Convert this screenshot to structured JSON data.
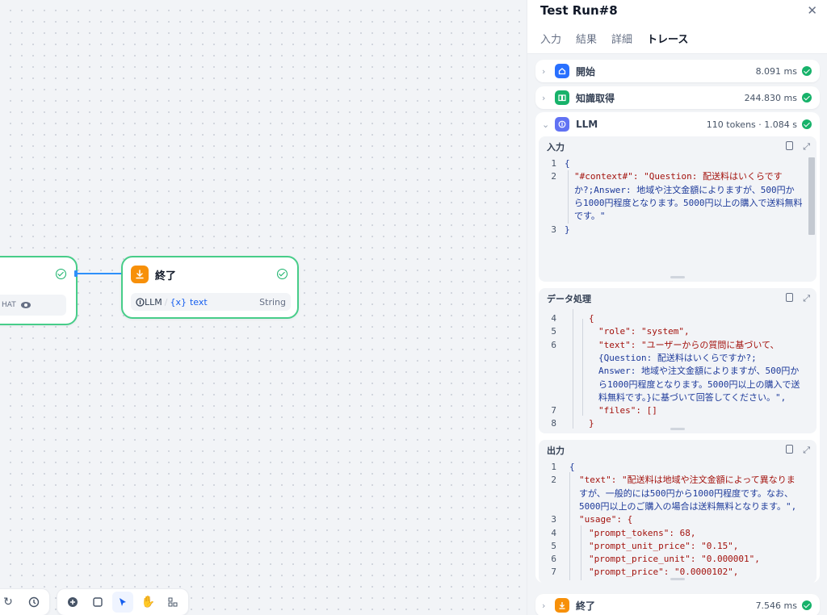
{
  "canvas": {
    "left_node": {
      "var_label": "HAT"
    },
    "end_node": {
      "title": "終了",
      "var_source": "LLM",
      "var_name": "text",
      "var_type": "String"
    }
  },
  "panel": {
    "title": "Test Run#8",
    "tabs": [
      "入力",
      "結果",
      "詳細",
      "トレース"
    ],
    "active_tab": "トレース",
    "trace": [
      {
        "title": "開始",
        "meta": "8.091 ms",
        "icon": "home-icon",
        "color": "#2970ff"
      },
      {
        "title": "知識取得",
        "meta": "244.830 ms",
        "icon": "book-icon",
        "color": "#17b26a"
      },
      {
        "title": "LLM",
        "meta": "110 tokens · 1.084 s",
        "icon": "llm-icon",
        "color": "#6172f3"
      },
      {
        "title": "終了",
        "meta": "7.546 ms",
        "icon": "end-icon",
        "color": "#f79009"
      }
    ],
    "input_section": {
      "title": "入力",
      "line_numbers": [
        "1",
        "2",
        "3"
      ],
      "lines": [
        "{",
        "\"#context#\": \"Question: 配送料はいくらです",
        "か?;Answer: 地域や注文金額によりますが、500円か",
        "ら1000円程度となります。5000円以上の購入で送料無料",
        "です。\"",
        "}"
      ]
    },
    "processing_section": {
      "title": "データ処理",
      "line_numbers": [
        "4",
        "5",
        "6",
        "7",
        "8"
      ],
      "lines": [
        "{",
        "\"role\": \"system\",",
        "\"text\": \"ユーザーからの質問に基づいて、",
        "{Question: 配送料はいくらですか?;",
        "Answer: 地域や注文金額によりますが、500円か",
        "ら1000円程度となります。5000円以上の購入で送",
        "料無料です。}に基づいて回答してください。\",",
        "\"files\": []",
        "}"
      ]
    },
    "output_section": {
      "title": "出力",
      "line_numbers": [
        "1",
        "2",
        "3",
        "4",
        "5",
        "6",
        "7"
      ],
      "lines": [
        "{",
        "\"text\": \"配送料は地域や注文金額によって異なりま",
        "すが、一般的には500円から1000円程度です。なお、",
        "5000円以上のご購入の場合は送料無料となります。\",",
        "\"usage\": {",
        "\"prompt_tokens\": 68,",
        "\"prompt_unit_price\": \"0.15\",",
        "\"prompt_price_unit\": \"0.000001\",",
        "\"prompt_price\": \"0.0000102\","
      ]
    }
  }
}
